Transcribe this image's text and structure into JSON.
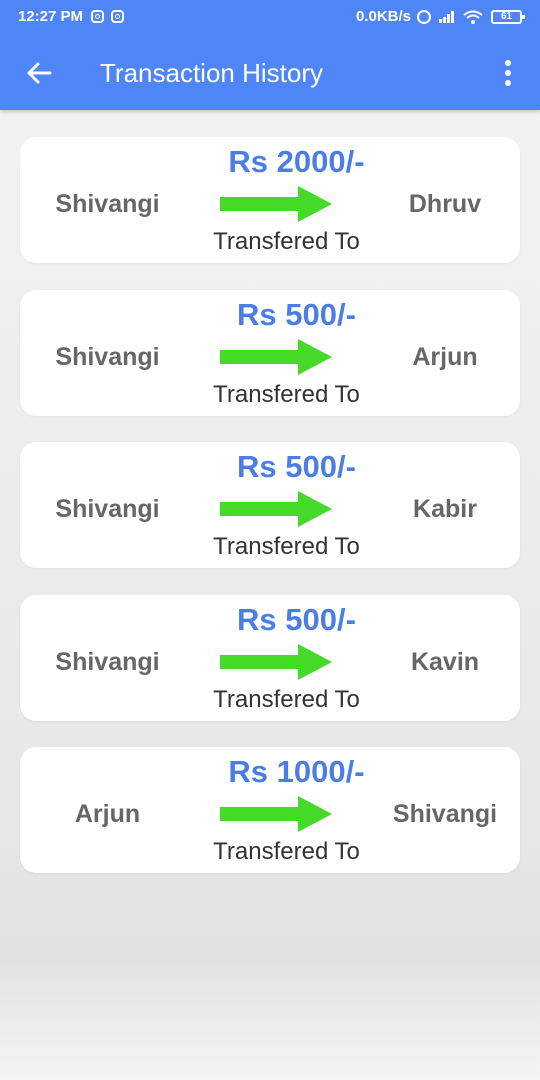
{
  "status_bar": {
    "time": "12:27 PM",
    "network_speed": "0.0KB/s",
    "battery": "61"
  },
  "app_bar": {
    "title": "Transaction History"
  },
  "icons": {
    "back": "arrow-left-icon",
    "more": "more-vert-icon",
    "transfer": "arrow-right-icon"
  },
  "colors": {
    "app_bar": "#4f86f7",
    "amount": "#4a7ee6",
    "arrow": "#45d928"
  },
  "transactions": [
    {
      "amount": "Rs 2000/-",
      "from": "Shivangi",
      "to": "Dhruv",
      "caption": "Transfered To"
    },
    {
      "amount": "Rs 500/-",
      "from": "Shivangi",
      "to": "Arjun",
      "caption": "Transfered To"
    },
    {
      "amount": "Rs 500/-",
      "from": "Shivangi",
      "to": "Kabir",
      "caption": "Transfered To"
    },
    {
      "amount": "Rs 500/-",
      "from": "Shivangi",
      "to": "Kavin",
      "caption": "Transfered To"
    },
    {
      "amount": "Rs 1000/-",
      "from": "Arjun",
      "to": "Shivangi",
      "caption": "Transfered To"
    }
  ]
}
